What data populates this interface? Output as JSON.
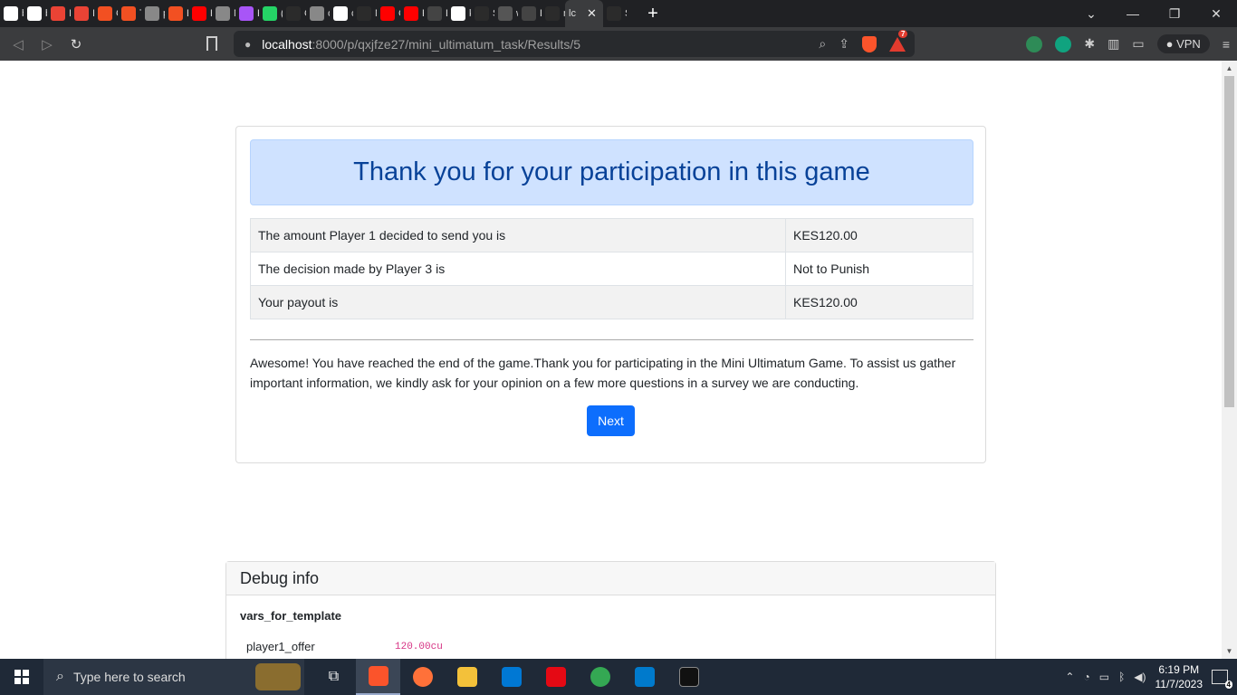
{
  "browser": {
    "tabs": [
      {
        "letter": "b",
        "icon": "github-icon",
        "color": "#ffffff"
      },
      {
        "letter": "b",
        "icon": "github-icon",
        "color": "#ffffff"
      },
      {
        "letter": "Ir",
        "icon": "gmail-icon",
        "color": "#ea4335"
      },
      {
        "letter": "Ir",
        "icon": "gmail-icon",
        "color": "#ea4335"
      },
      {
        "letter": "C",
        "icon": "microsoft-icon",
        "color": "#f25022"
      },
      {
        "letter": "T",
        "icon": "microsoft-icon",
        "color": "#f25022"
      },
      {
        "letter": "p",
        "icon": "globe-icon",
        "color": "#888888"
      },
      {
        "letter": "E",
        "icon": "microsoft-icon",
        "color": "#f25022"
      },
      {
        "letter": "H",
        "icon": "youtube-icon",
        "color": "#ff0000"
      },
      {
        "letter": "M",
        "icon": "globe-icon",
        "color": "#888888"
      },
      {
        "letter": "P",
        "icon": "pod-icon",
        "color": "#a855f7"
      },
      {
        "letter": "(E",
        "icon": "whatsapp-icon",
        "color": "#25d366"
      },
      {
        "letter": "C",
        "icon": "dark-icon",
        "color": "#2b2b2b"
      },
      {
        "letter": "o",
        "icon": "globe-icon",
        "color": "#888888"
      },
      {
        "letter": "o",
        "icon": "blank-icon",
        "color": "#ffffff"
      },
      {
        "letter": "M",
        "icon": "dark-icon",
        "color": "#2b2b2b"
      },
      {
        "letter": "C",
        "icon": "youtube-icon",
        "color": "#ff0000"
      },
      {
        "letter": "F",
        "icon": "youtube-icon",
        "color": "#ff0000"
      },
      {
        "letter": "D",
        "icon": "download-icon",
        "color": "#444444"
      },
      {
        "letter": "k",
        "icon": "vercel-icon",
        "color": "#ffffff"
      },
      {
        "letter": "S",
        "icon": "dark-icon",
        "color": "#2b2b2b"
      },
      {
        "letter": "w",
        "icon": "people-icon",
        "color": "#555555"
      },
      {
        "letter": "D",
        "icon": "slash-icon",
        "color": "#444444"
      },
      {
        "letter": "m",
        "icon": "dark-icon",
        "color": "#2b2b2b"
      }
    ],
    "active_tab": {
      "letter": "lc",
      "close": "✕"
    },
    "after_active": {
      "letter": "S"
    },
    "new_tab": "+",
    "url_host": "localhost",
    "url_path": ":8000/p/qxjfze27/mini_ultimatum_task/Results/5",
    "brave_badge": "7",
    "vpn_label": "VPN"
  },
  "page": {
    "title": "Thank you for your participation in this game",
    "results": [
      {
        "label": "The amount Player 1 decided to send you is",
        "value": "KES120.00"
      },
      {
        "label": "The decision made by Player 3 is",
        "value": "Not to Punish"
      },
      {
        "label": "Your payout is",
        "value": "KES120.00"
      }
    ],
    "message": "Awesome! You have reached the end of the game.Thank you for participating in the Mini Ultimatum Game. To assist us gather important information, we kindly ask for your opinion on a few more questions in a survey we are conducting.",
    "next_label": "Next"
  },
  "debug": {
    "heading": "Debug info",
    "section": "vars_for_template",
    "vars": [
      {
        "key": "player1_offer",
        "value": "120.00cu"
      }
    ]
  },
  "taskbar": {
    "search_placeholder": "Type here to search",
    "time": "6:19 PM",
    "date": "11/7/2023",
    "notifications": "4"
  }
}
